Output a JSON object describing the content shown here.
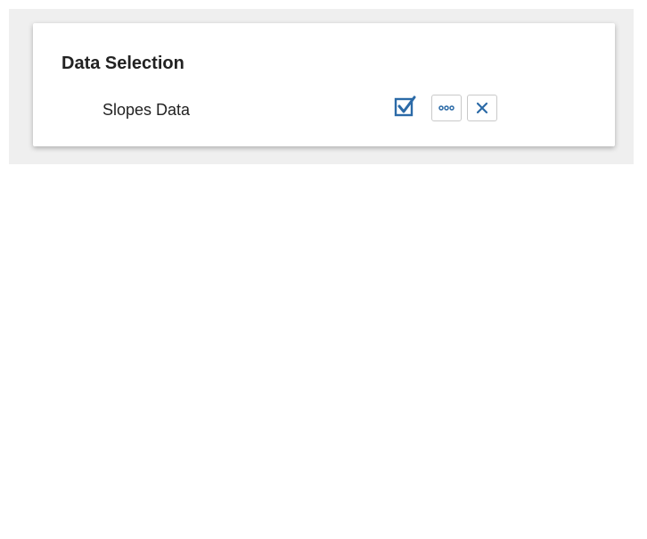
{
  "panel": {
    "title": "Data Selection"
  },
  "selection": {
    "item_label": "Slopes Data",
    "actions": {
      "select_icon": "checkbox-check-icon",
      "more_icon": "ellipsis-icon",
      "remove_icon": "close-icon"
    }
  },
  "colors": {
    "accent": "#2b6aa7",
    "panel_background": "#efefef",
    "card_background": "#ffffff",
    "text": "#222222"
  }
}
